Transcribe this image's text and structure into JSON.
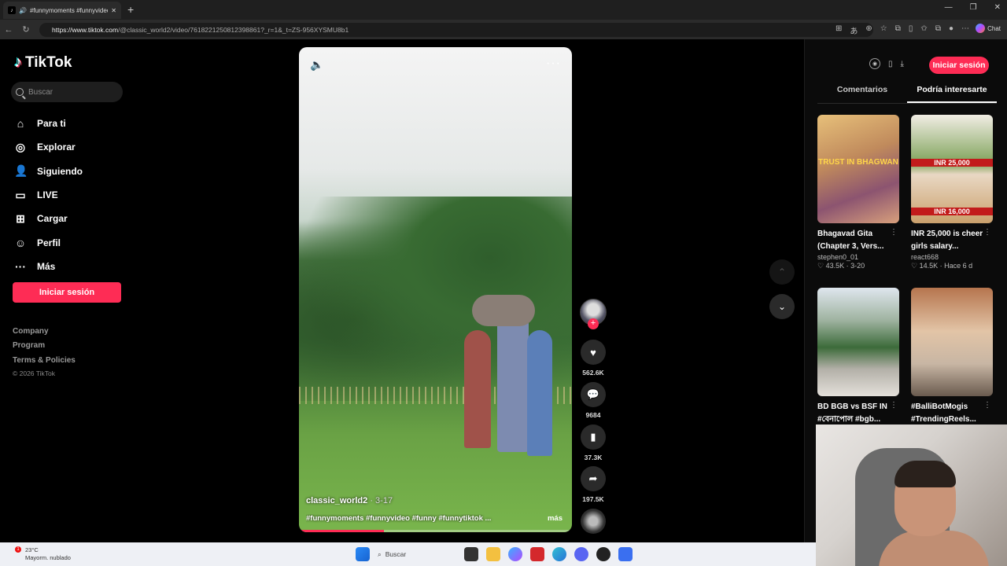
{
  "browser": {
    "tab_title": "#funnymoments #funnyvideo",
    "url_host": "https://www.tiktok.com",
    "url_path": "/@classic_world2/video/7618221250812398861?_r=1&_t=ZS-956XYSMU8b1",
    "chat_label": "Chat"
  },
  "sidebar": {
    "logo": "TikTok",
    "search_placeholder": "Buscar",
    "nav": [
      {
        "label": "Para ti",
        "icon": "home-icon"
      },
      {
        "label": "Explorar",
        "icon": "compass-icon"
      },
      {
        "label": "Siguiendo",
        "icon": "following-icon"
      },
      {
        "label": "LIVE",
        "icon": "live-icon"
      },
      {
        "label": "Cargar",
        "icon": "upload-icon"
      },
      {
        "label": "Perfil",
        "icon": "profile-icon"
      },
      {
        "label": "Más",
        "icon": "more-icon"
      }
    ],
    "login_button": "Iniciar sesión",
    "footer": [
      "Company",
      "Program",
      "Terms & Policies"
    ],
    "copyright": "© 2026 TikTok"
  },
  "video": {
    "author": "classic_world2",
    "date": " · 3-17",
    "caption": "#funnymoments #funnyvideo #funny #funnytiktok ...",
    "more_label": "más",
    "progress": 0.31
  },
  "actions": {
    "likes": "562.6K",
    "comments": "9684",
    "saves": "37.3K",
    "shares": "197.5K"
  },
  "right_panel": {
    "login_button": "Iniciar sesión",
    "tabs": [
      "Comentarios",
      "Podría interesarte"
    ],
    "active_tab": 1,
    "cards": [
      {
        "title": "Bhagavad Gita (Chapter 3, Vers...",
        "author": "stephen0_01",
        "meta": "♡ 43.5K · 3-20",
        "thumb_text": "TRUST IN BHAGWAN"
      },
      {
        "title": "INR 25,000 is cheer girls salary...",
        "author": "react668",
        "meta": "♡ 14.5K · Hace 6 d",
        "thumb_text": "INR 25,000",
        "thumb_text2": "INR 16,000"
      },
      {
        "title": "BD BGB vs BSF IN #বেনাপোল #bgb...",
        "author": "",
        "meta": "",
        "thumb_text": ""
      },
      {
        "title": "#BalliBotMogis #TrendingReels...",
        "author": "",
        "meta": "",
        "thumb_text": ""
      }
    ]
  },
  "taskbar": {
    "temperature": "23°C",
    "weather": "Mayorm. nublado",
    "search": "Buscar",
    "badge": "1"
  }
}
